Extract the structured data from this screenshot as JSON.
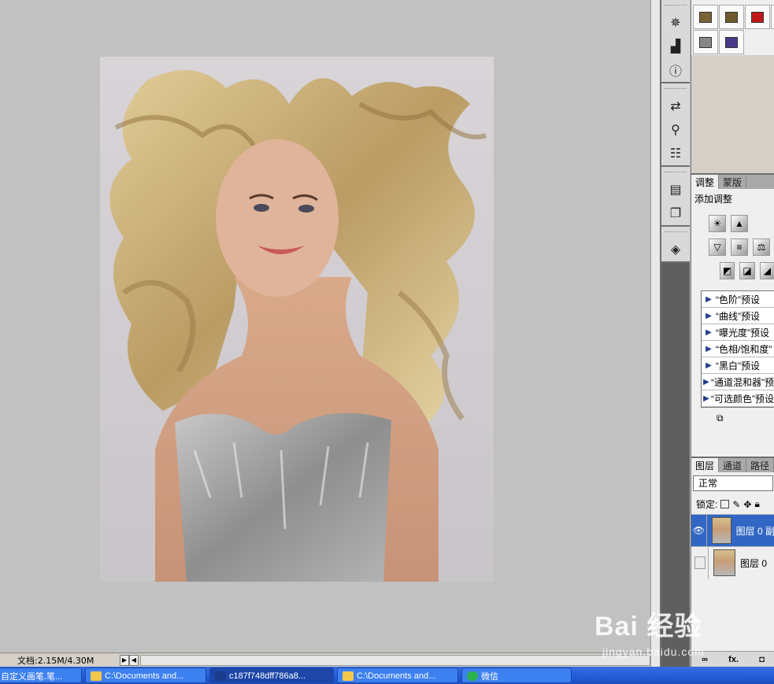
{
  "statusbar": {
    "doc_size": "文档:2.15M/4.30M"
  },
  "icon_dock": {
    "icons": [
      "navigator-icon",
      "histogram-icon",
      "info-icon",
      "brushes-icon",
      "clone-source-icon",
      "tool-presets-icon",
      "character-icon",
      "paragraph-icon",
      "layer-comps-icon"
    ]
  },
  "styles_panel": {
    "swatch_colors": [
      "#7a6434",
      "#6e5a2c",
      "#c01818",
      "#d06a3a",
      "#888888",
      "#4a3a8c"
    ]
  },
  "adjustments": {
    "tabs": [
      "调整",
      "蒙版"
    ],
    "title": "添加调整",
    "presets": [
      "“色阶”预设",
      "“曲线”预设",
      "“曝光度”预设",
      "“色相/饱和度”",
      "“黑白”预设",
      "“通道混和器”预",
      "“可选颜色”预设"
    ]
  },
  "layers": {
    "tabs": [
      "图层",
      "通道",
      "路径"
    ],
    "blend_mode": "正常",
    "lock_label": "锁定:",
    "items": [
      {
        "name": "图层 0 副",
        "visible": true,
        "selected": true
      },
      {
        "name": "图层 0",
        "visible": false,
        "selected": false
      }
    ],
    "footer_fx": "fx."
  },
  "taskbar": {
    "tasks": [
      {
        "label": "自定义画笔.笔...",
        "icon_color": "#f3c84a"
      },
      {
        "label": "C:\\Documents and...",
        "icon_color": "#f3c84a"
      },
      {
        "label": "c187f748dff786a8...",
        "icon_color": "#1a3b8c",
        "active": true
      },
      {
        "label": "C:\\Documents and...",
        "icon_color": "#f3c84a"
      },
      {
        "label": "微信",
        "icon_color": "#2ab34a"
      }
    ]
  },
  "watermark": {
    "logo": "Bai 经验",
    "url": "jingyan.baidu.com"
  },
  "colors": {
    "selection_blue": "#3166c4",
    "taskbar_blue": "#245edb",
    "workspace_gray": "#c1c1c1"
  }
}
